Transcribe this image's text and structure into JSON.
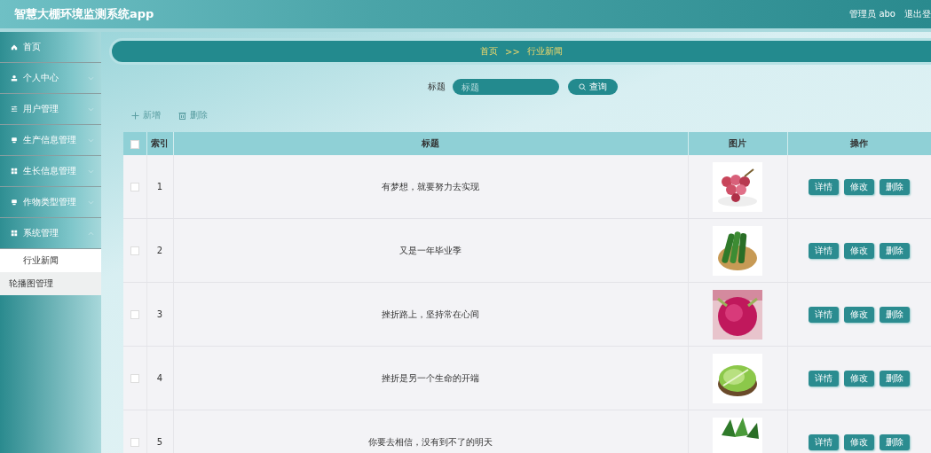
{
  "header": {
    "title": "智慧大棚环境监测系统app",
    "user": "管理员 abo",
    "logout": "退出登"
  },
  "sidebar": {
    "items": [
      {
        "label": "首页",
        "kind": "home",
        "selected": false
      },
      {
        "label": "个人中心",
        "kind": "user",
        "expanded": false,
        "selected": false
      },
      {
        "label": "用户管理",
        "kind": "sliders",
        "expanded": false,
        "selected": false
      },
      {
        "label": "生产信息管理",
        "kind": "screen",
        "expanded": false,
        "selected": false
      },
      {
        "label": "生长信息管理",
        "kind": "grid",
        "expanded": false,
        "selected": false
      },
      {
        "label": "作物类型管理",
        "kind": "screen",
        "expanded": false,
        "selected": false
      },
      {
        "label": "系统管理",
        "kind": "grid",
        "expanded": true,
        "selected": false,
        "children": [
          {
            "label": "行业新闻",
            "selected": true
          },
          {
            "label": "轮播图管理",
            "selected": false
          }
        ]
      }
    ]
  },
  "breadcrumb": [
    "首页",
    ">>",
    "行业新闻"
  ],
  "search": {
    "label": "标题",
    "placeholder": "标题",
    "button": "查询"
  },
  "toolbar": [
    {
      "label": "新增",
      "kind": "add"
    },
    {
      "label": "删除",
      "kind": "delete"
    }
  ],
  "table": {
    "all_checked": false,
    "columns": [
      "索引",
      "标题",
      "图片",
      "操作"
    ],
    "rows": [
      {
        "checked": false,
        "index": "1",
        "title": "有梦想，就要努力去实现",
        "image": {
          "kind": "picture"
        },
        "actions": [
          "详情",
          "修改",
          "删除"
        ]
      },
      {
        "checked": false,
        "index": "2",
        "title": "又是一年毕业季",
        "image": {
          "kind": "picture"
        },
        "actions": [
          "详情",
          "修改",
          "删除"
        ]
      },
      {
        "checked": false,
        "index": "3",
        "title": "挫折路上，坚持常在心间",
        "image": {
          "kind": "picture"
        },
        "actions": [
          "详情",
          "修改",
          "删除"
        ]
      },
      {
        "checked": false,
        "index": "4",
        "title": "挫折是另一个生命的开端",
        "image": {
          "kind": "picture"
        },
        "actions": [
          "详情",
          "修改",
          "删除"
        ]
      },
      {
        "checked": false,
        "index": "5",
        "title": "你要去相信，没有到不了的明天",
        "image": {
          "kind": "picture"
        },
        "actions": [
          "详情",
          "修改",
          "删除"
        ]
      }
    ]
  }
}
